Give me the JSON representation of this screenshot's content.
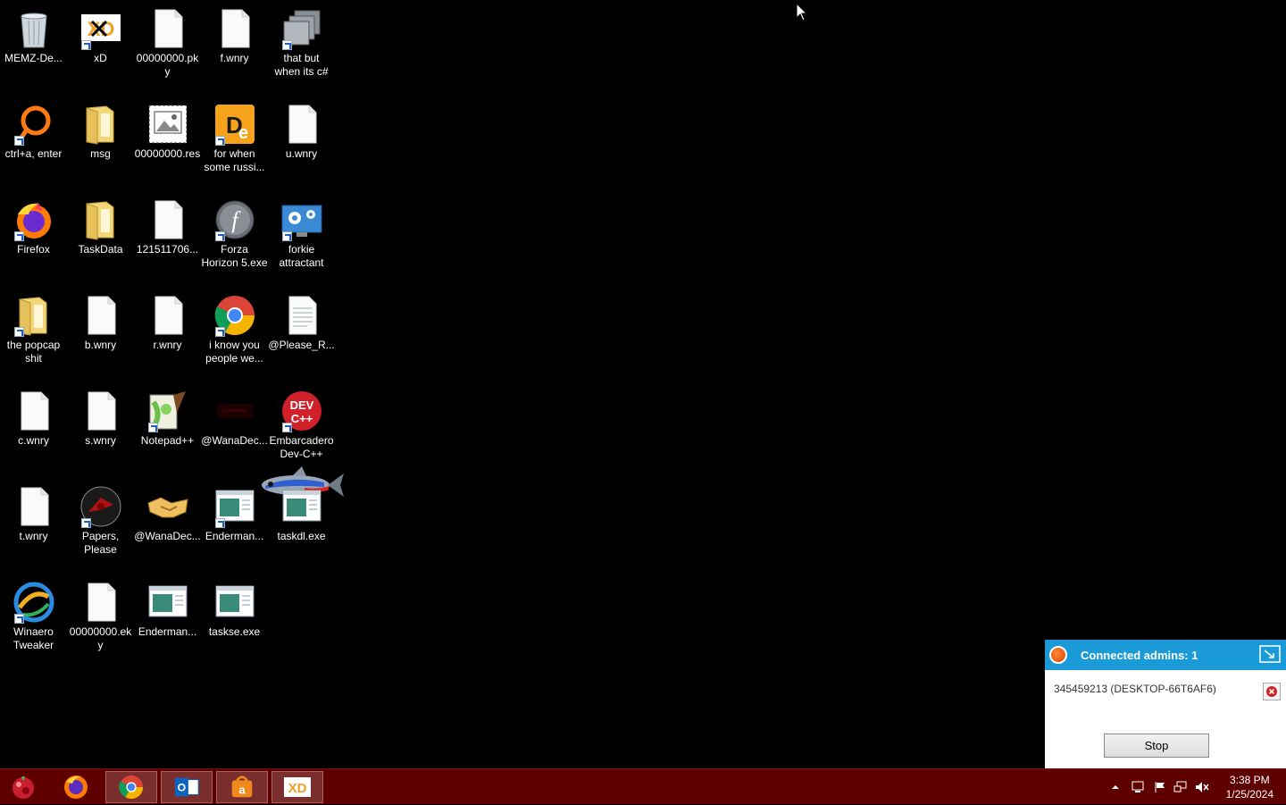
{
  "desktop": {
    "icons": [
      {
        "label": "MEMZ-De...",
        "icon": "recycle-bin-icon"
      },
      {
        "label": "xD",
        "icon": "xd-icon"
      },
      {
        "label": "00000000.pky",
        "icon": "file-icon"
      },
      {
        "label": "f.wnry",
        "icon": "file-icon"
      },
      {
        "label": "that but\nwhen its c#",
        "icon": "stacked-windows-icon"
      },
      {
        "label": "ctrl+a, enter",
        "icon": "orange-ring-icon"
      },
      {
        "label": "msg",
        "icon": "folder-icon"
      },
      {
        "label": "00000000.res",
        "icon": "image-file-icon"
      },
      {
        "label": "for when\nsome russi...",
        "icon": "de-app-icon"
      },
      {
        "label": "u.wnry",
        "icon": "file-icon"
      },
      {
        "label": "Firefox",
        "icon": "firefox-icon"
      },
      {
        "label": "TaskData",
        "icon": "folder-icon"
      },
      {
        "label": "121511706...",
        "icon": "file-icon"
      },
      {
        "label": "Forza\nHorizon 5.exe",
        "icon": "flash-icon"
      },
      {
        "label": "forkie\nattractant",
        "icon": "settings-monitor-icon"
      },
      {
        "label": "the popcap\nshit",
        "icon": "folder-icon"
      },
      {
        "label": "b.wnry",
        "icon": "file-icon"
      },
      {
        "label": "r.wnry",
        "icon": "file-icon"
      },
      {
        "label": "i know you\npeople we...",
        "icon": "chrome-icon"
      },
      {
        "label": "@Please_R...",
        "icon": "text-file-icon"
      },
      {
        "label": "c.wnry",
        "icon": "file-icon"
      },
      {
        "label": "s.wnry",
        "icon": "file-icon"
      },
      {
        "label": "Notepad++",
        "icon": "notepadpp-icon"
      },
      {
        "label": "@WanaDec...",
        "icon": "dark-app-icon"
      },
      {
        "label": "Embarcadero\nDev-C++",
        "icon": "devcpp-icon"
      },
      {
        "label": "t.wnry",
        "icon": "file-icon"
      },
      {
        "label": "Papers,\nPlease",
        "icon": "papers-please-icon"
      },
      {
        "label": "@WanaDec...",
        "icon": "handshake-icon"
      },
      {
        "label": "Enderman...",
        "icon": "exe-window-icon"
      },
      {
        "label": "taskdl.exe",
        "icon": "exe-window-icon"
      },
      {
        "label": "Winaero\nTweaker",
        "icon": "winaero-icon"
      },
      {
        "label": "00000000.eky",
        "icon": "file-icon"
      },
      {
        "label": "Enderman...",
        "icon": "exe-window-icon"
      },
      {
        "label": "taskse.exe",
        "icon": "exe-window-icon"
      }
    ]
  },
  "taskbar": {
    "start_icon": "start-orb-icon",
    "apps": [
      {
        "name": "Firefox",
        "icon": "firefox-icon"
      },
      {
        "name": "Chrome",
        "icon": "chrome-icon"
      },
      {
        "name": "Outlook",
        "icon": "outlook-icon"
      },
      {
        "name": "Installer",
        "icon": "installer-icon"
      },
      {
        "name": "xD",
        "icon": "xd-icon"
      }
    ],
    "clock": {
      "time": "3:38 PM",
      "date": "1/25/2024"
    }
  },
  "admin_panel": {
    "title": "Connected admins: 1",
    "session": "345459213 (DESKTOP-66T6AF6)",
    "stop_label": "Stop",
    "header_color": "#1a9bd7"
  },
  "colors": {
    "taskbar": "#5f0000",
    "desktop": "#000000"
  }
}
